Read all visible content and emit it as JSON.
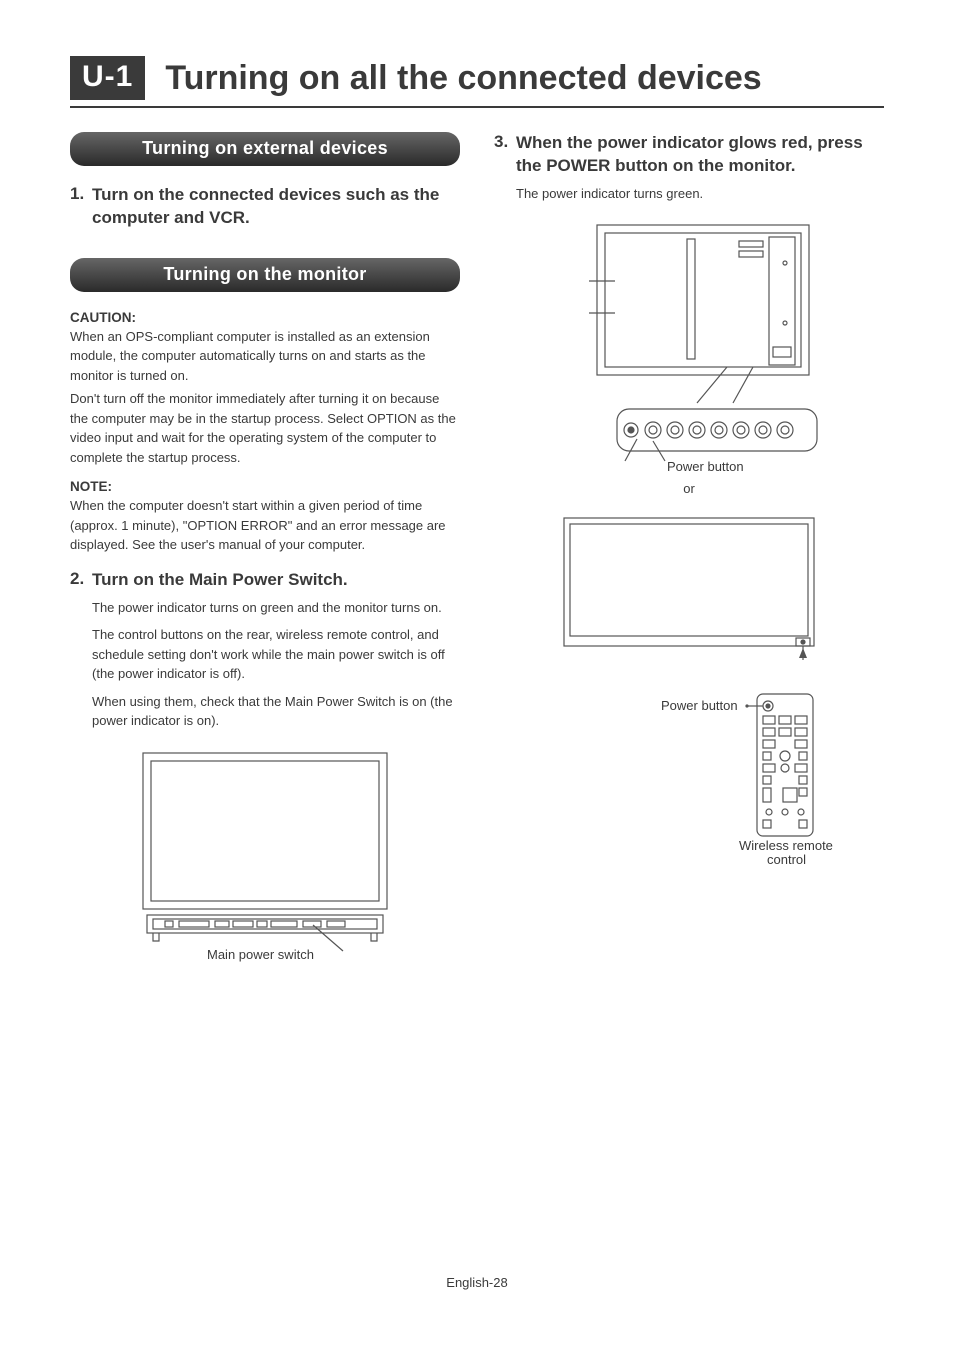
{
  "header": {
    "chip": "U-1",
    "title": "Turning on all the connected devices"
  },
  "left": {
    "section1_title": "Turning on external devices",
    "step1_num": "1.",
    "step1_head": "Turn on the connected devices such as the computer and VCR.",
    "section2_title": "Turning on the monitor",
    "caution_label": "CAUTION:",
    "caution_p1": "When an OPS-compliant computer is installed as an extension module, the computer automatically turns on and starts as the monitor is turned on.",
    "caution_p2": "Don't turn off the monitor immediately after turning it on because the computer may be in the startup process. Select OPTION as the video input and wait for the operating system of the computer to complete the startup process.",
    "note_label": "NOTE:",
    "note_p1": "When the computer doesn't start within a given period of time (approx. 1 minute), \"OPTION ERROR\" and an error message are displayed. See the user's manual of your computer.",
    "step2_num": "2.",
    "step2_head": "Turn on the Main Power Switch.",
    "step2_p1": "The power indicator turns on green and the monitor turns on.",
    "step2_p2": "The control buttons on the rear, wireless remote control, and schedule setting don't work while the main power switch is off (the power indicator is off).",
    "step2_p3": "When using them, check that the Main Power Switch is on (the power indicator is on).",
    "diagram1_caption": "Main power switch"
  },
  "right": {
    "step3_num": "3.",
    "step3_head": "When the power indicator glows red, press the POWER button on the monitor.",
    "step3_p1": "The power indicator turns green.",
    "diagram2_caption": "Power button",
    "or": "or",
    "diagram3_caption": "Power button",
    "diagram4_caption": "Wireless remote control"
  },
  "footer": "English-28"
}
